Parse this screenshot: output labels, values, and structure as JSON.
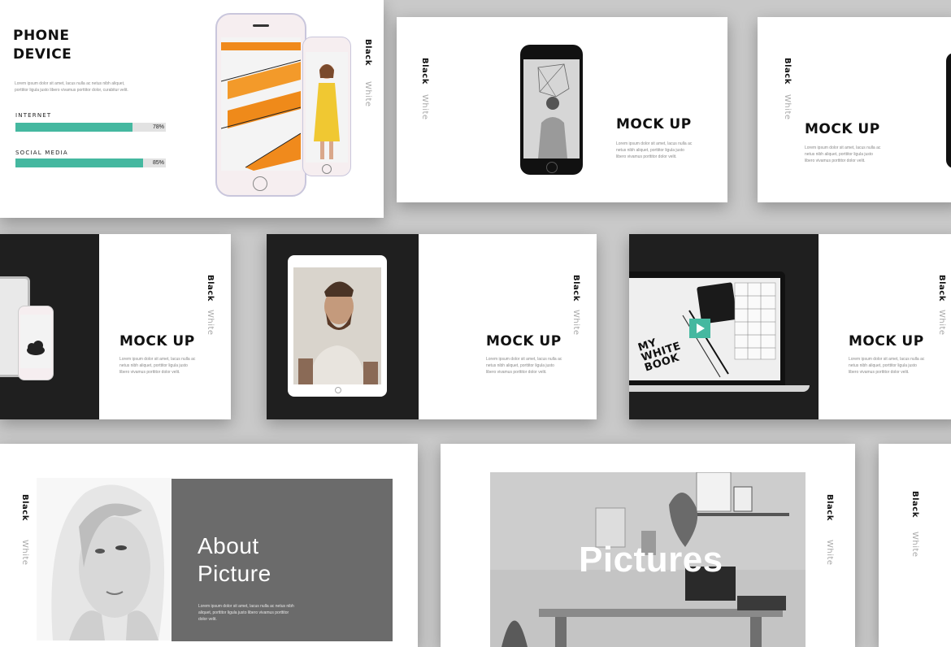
{
  "slide1": {
    "title_line1": "PHONE",
    "title_line2": "DEVICE",
    "body": "Lorem ipsum dolor sit amet, lacus nulla ac netus nibh aliquet, porttitor ligula justo libero vivamus porttitor dolor, curabitur velit.",
    "bars": [
      {
        "label": "INTERNET",
        "percent": 78,
        "percent_label": "78%"
      },
      {
        "label": "SOCIAL MEDIA",
        "percent": 85,
        "percent_label": "85%"
      }
    ],
    "side_black": "Black",
    "side_white": "White"
  },
  "slide2": {
    "title": "MOCK UP",
    "body": "Lorem ipsum dolor sit amet, lacus nulla ac netus nibh aliquet, porttitor ligula justo libero vivamus porttitor dolor velit.",
    "side_black": "Black",
    "side_white": "White"
  },
  "slide3": {
    "title": "MOCK UP",
    "body": "Lorem ipsum dolor sit amet, lacus nulla ac netus nibh aliquet, porttitor ligula justo libero vivamus porttitor dolor velit.",
    "side_black": "Black",
    "side_white": "White"
  },
  "slide4": {
    "title": "MOCK UP",
    "body": "Lorem ipsum dolor sit amet, lacus nulla ac netus nibh aliquet, porttitor ligula justo libero vivamus porttitor dolor velit.",
    "side_black": "Black",
    "side_white": "White"
  },
  "slide5": {
    "title": "MOCK UP",
    "body": "Lorem ipsum dolor sit amet, lacus nulla ac netus nibh aliquet, porttitor ligula justo libero vivamus porttitor dolor velit.",
    "side_black": "Black",
    "side_white": "White"
  },
  "slide6": {
    "title": "MOCK UP",
    "body": "Lorem ipsum dolor sit amet, lacus nulla ac netus nibh aliquet, porttitor ligula justo libero vivamus porttitor dolor velit.",
    "side_black": "Black",
    "side_white": "White",
    "book_text": "MY WHITE BOOK"
  },
  "slide7": {
    "title_line1": "About",
    "title_line2": "Picture",
    "body": "Lorem ipsum dolor sit amet, lacus nulla ac netus nibh aliquet, porttitor ligula justo libero vivamus porttitor dolor velit.",
    "side_black": "Black",
    "side_white": "White"
  },
  "slide8": {
    "title": "Pictures",
    "side_black": "Black",
    "side_white": "White"
  },
  "slide9": {
    "side_black": "Black",
    "side_white": "White"
  },
  "colors": {
    "accent": "#45b8a0",
    "dark": "#1f1f1f",
    "gray_panel": "#6b6b6b"
  }
}
